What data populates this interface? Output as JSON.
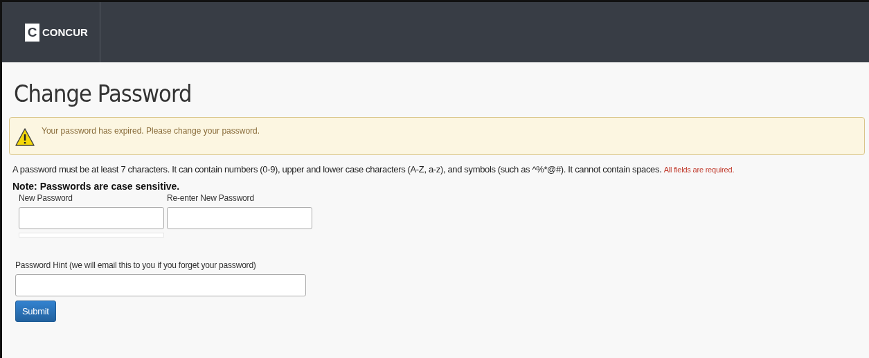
{
  "header": {
    "logo": {
      "mark": "C",
      "text": "CONCUR"
    }
  },
  "page": {
    "title": "Change Password"
  },
  "alert": {
    "message": "Your password has expired. Please change your password."
  },
  "rules": {
    "text": "A password must be at least 7 characters. It can contain numbers (0-9), upper and lower case characters (A-Z, a-z), and symbols (such as ^%*@#). It cannot contain spaces.",
    "required_note": "All fields are required."
  },
  "note": "Note: Passwords are case sensitive.",
  "password_fields": [
    {
      "label": "New Password",
      "strength_meter": true
    },
    {
      "label": "Re-enter New Password",
      "strength_meter": false
    }
  ],
  "hint_field": {
    "label": "Password Hint (we will email this to you if you forget your password)"
  },
  "buttons": [
    {
      "label": "Submit"
    }
  ]
}
